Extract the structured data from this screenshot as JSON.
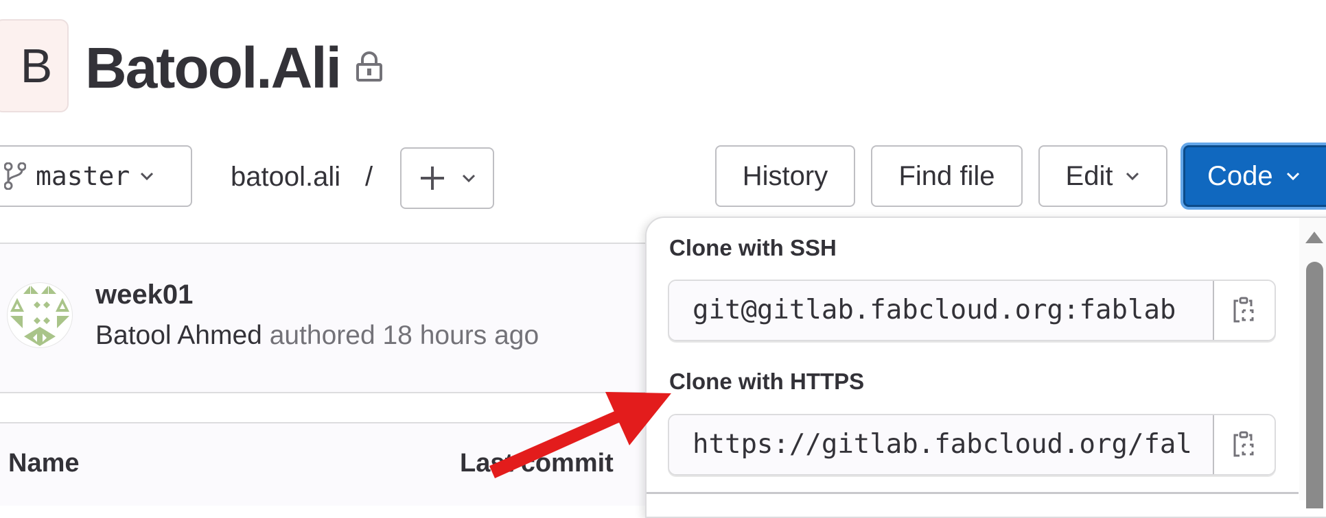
{
  "header": {
    "avatar_letter": "B",
    "title": "Batool.Ali",
    "visibility_icon": "lock-icon"
  },
  "toolbar": {
    "branch": "master",
    "branch_icon": "git-branch-icon",
    "breadcrumb": "batool.ali",
    "breadcrumb_separator": "/",
    "add_icon": "plus-icon",
    "history_label": "History",
    "find_file_label": "Find file",
    "edit_label": "Edit",
    "code_label": "Code"
  },
  "commit": {
    "title": "week01",
    "author": "Batool Ahmed",
    "meta": "authored 18 hours ago"
  },
  "table": {
    "columns": [
      "Name",
      "Last commit"
    ]
  },
  "clone_dropdown": {
    "ssh_label": "Clone with SSH",
    "ssh_url": "git@gitlab.fabcloud.org:fablab",
    "https_label": "Clone with HTTPS",
    "https_url": "https://gitlab.fabcloud.org/fal",
    "copy_icon": "copy-to-clipboard-icon"
  },
  "colors": {
    "primary": "#1068bf",
    "annotation_arrow": "#e31c1c",
    "avatar_pattern": "#a9c489"
  }
}
